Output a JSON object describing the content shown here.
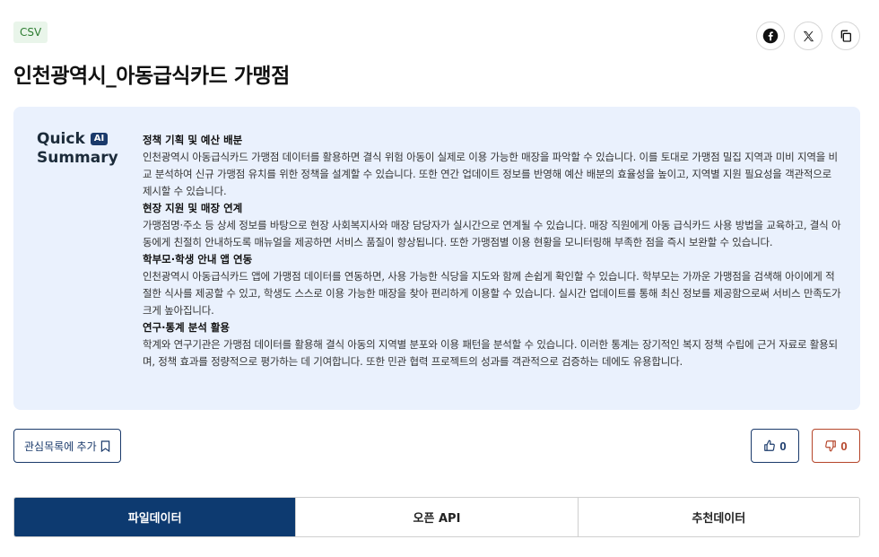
{
  "header": {
    "format_badge": "CSV",
    "title": "인천광역시_아동급식카드 가맹점"
  },
  "share": {
    "icons": [
      "facebook-icon",
      "x-icon",
      "copy-icon"
    ]
  },
  "summary": {
    "heading_line1": "Quick",
    "ai_badge": "AI",
    "heading_line2": "Summary",
    "sections": [
      {
        "title": "정책 기획 및 예산 배분",
        "body": "인천광역시 아동급식카드 가맹점 데이터를 활용하면 결식 위험 아동이 실제로 이용 가능한 매장을 파악할 수 있습니다. 이를 토대로 가맹점 밀집 지역과 미비 지역을 비교 분석하여 신규 가맹점 유치를 위한 정책을 설계할 수 있습니다. 또한 연간 업데이트 정보를 반영해 예산 배분의 효율성을 높이고, 지역별 지원 필요성을 객관적으로 제시할 수 있습니다."
      },
      {
        "title": "현장 지원 및 매장 연계",
        "body": "가맹점명·주소 등 상세 정보를 바탕으로 현장 사회복지사와 매장 담당자가 실시간으로 연계될 수 있습니다. 매장 직원에게 아동 급식카드 사용 방법을 교육하고, 결식 아동에게 친절히 안내하도록 매뉴얼을 제공하면 서비스 품질이 향상됩니다. 또한 가맹점별 이용 현황을 모니터링해 부족한 점을 즉시 보완할 수 있습니다."
      },
      {
        "title": "학부모·학생 안내 앱 연동",
        "body": "인천광역시 아동급식카드 앱에 가맹점 데이터를 연동하면, 사용 가능한 식당을 지도와 함께 손쉽게 확인할 수 있습니다. 학부모는 가까운 가맹점을 검색해 아이에게 적절한 식사를 제공할 수 있고, 학생도 스스로 이용 가능한 매장을 찾아 편리하게 이용할 수 있습니다. 실시간 업데이트를 통해 최신 정보를 제공함으로써 서비스 만족도가 크게 높아집니다."
      },
      {
        "title": "연구·통계 분석 활용",
        "body": "학계와 연구기관은 가맹점 데이터를 활용해 결식 아동의 지역별 분포와 이용 패턴을 분석할 수 있습니다. 이러한 통계는 장기적인 복지 정책 수립에 근거 자료로 활용되며, 정책 효과를 정량적으로 평가하는 데 기여합니다. 또한 민관 협력 프로젝트의 성과를 객관적으로 검증하는 데에도 유용합니다."
      }
    ]
  },
  "actions": {
    "favorite_label": "관심목록에 추가",
    "like_count": "0",
    "dislike_count": "0"
  },
  "tabs": [
    {
      "label": "파일데이터",
      "active": true
    },
    {
      "label": "오픈 API",
      "active": false
    },
    {
      "label": "추천데이터",
      "active": false
    }
  ],
  "colors": {
    "primary": "#0d3a70",
    "summary_bg": "#eaf1fd",
    "badge_bg": "#e9f5ea",
    "dislike": "#b5452a"
  }
}
